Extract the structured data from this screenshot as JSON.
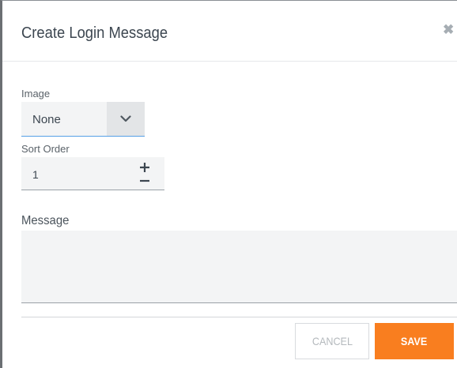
{
  "dialog": {
    "title": "Create Login Message",
    "close_icon": "close-icon"
  },
  "image_field": {
    "label": "Image",
    "selected": "None",
    "dropdown_icon": "chevron-down-icon"
  },
  "sort_field": {
    "label": "Sort Order",
    "value": "1",
    "increment_icon": "plus-icon",
    "decrement_icon": "minus-icon"
  },
  "message_field": {
    "label": "Message",
    "value": ""
  },
  "footer": {
    "cancel_label": "CANCEL",
    "save_label": "SAVE"
  },
  "colors": {
    "accent": "#f97e1f",
    "focus_underline": "#56a0e6",
    "field_background": "#f3f4f5"
  }
}
